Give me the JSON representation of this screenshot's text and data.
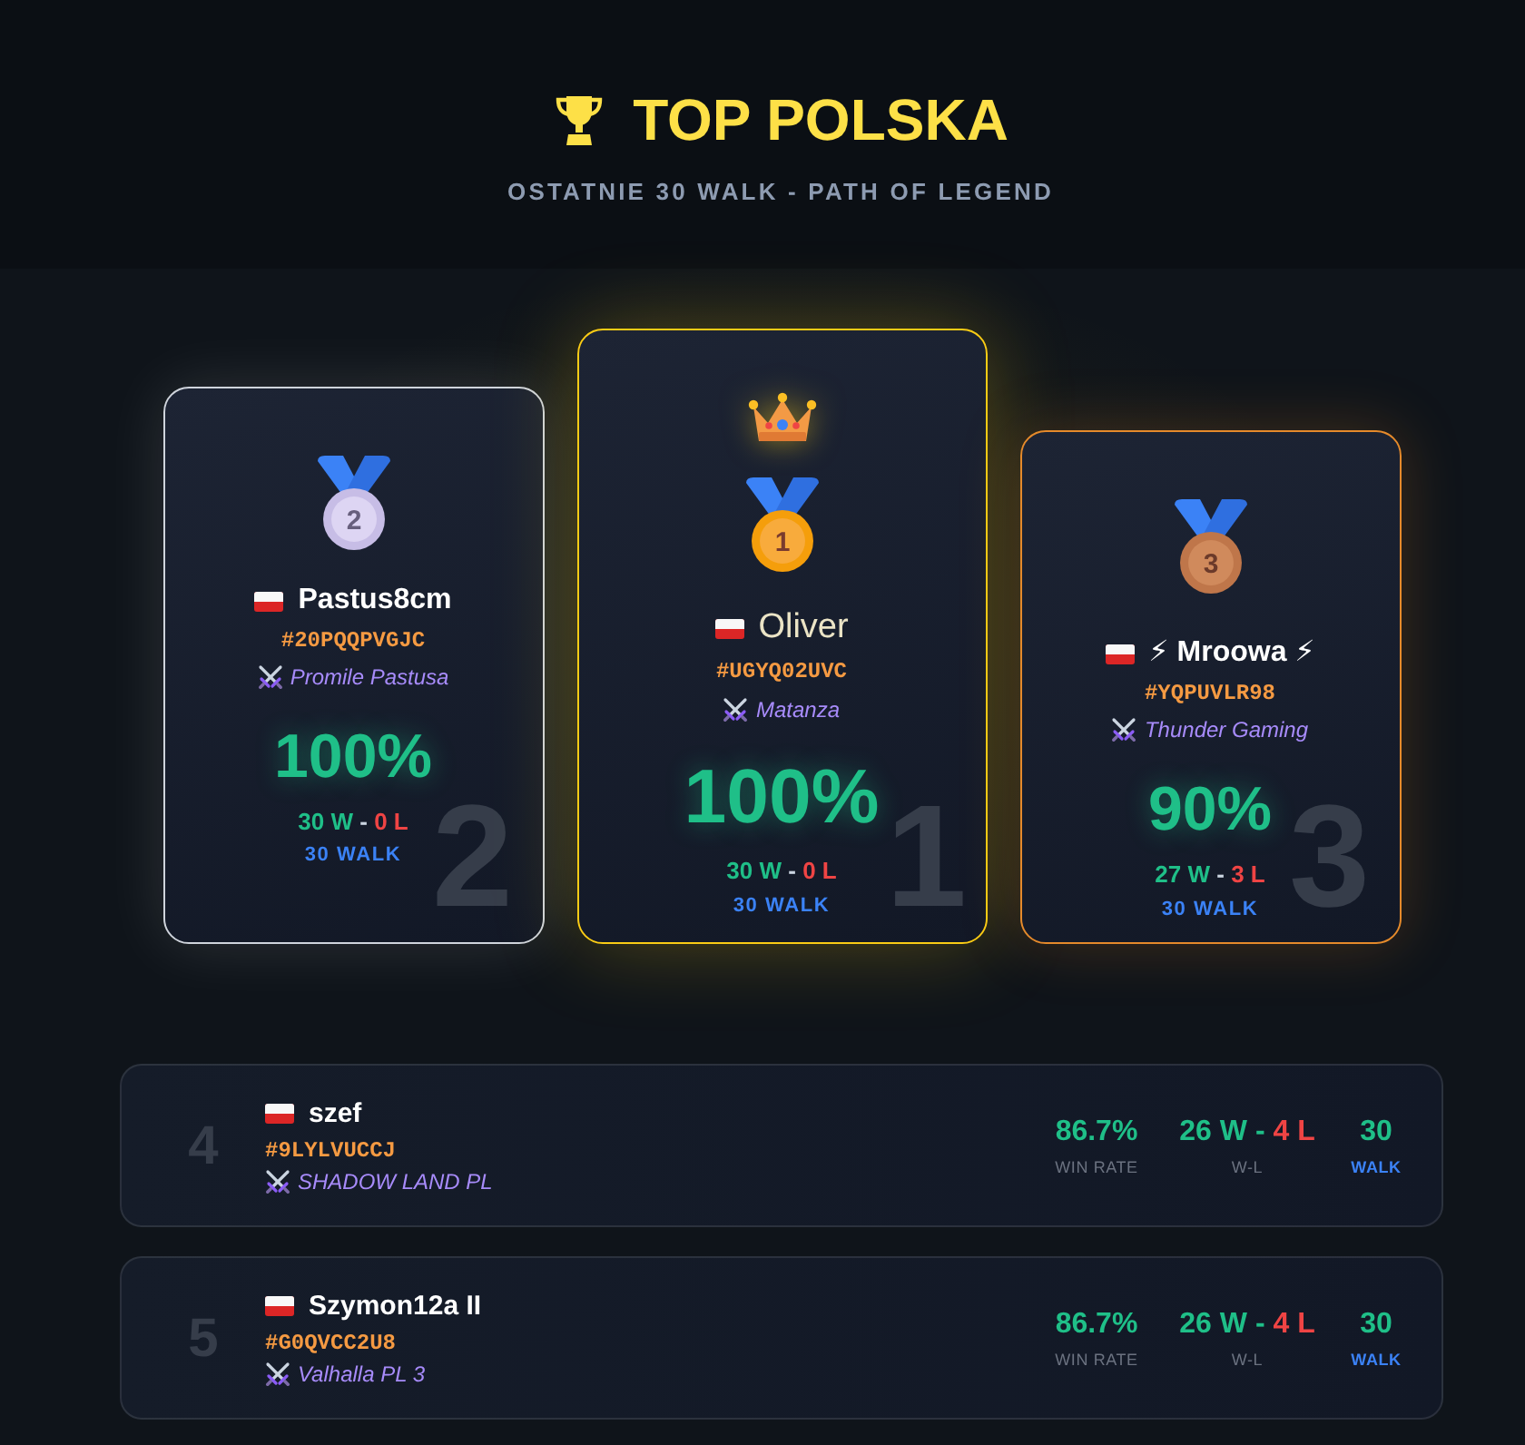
{
  "header": {
    "title": "TOP POLSKA",
    "subtitle": "OSTATNIE 30 WALK - PATH OF LEGEND"
  },
  "podium": [
    {
      "kind": "silver",
      "crown": false,
      "medal": "2",
      "name": "Pastus8cm",
      "tag": "#20PQQPVGJC",
      "clan": "Promile Pastusa",
      "win_rate": "100%",
      "wins": "30 W",
      "dash": "-",
      "losses": "0 L",
      "battles": "30 WALK",
      "rank": "2"
    },
    {
      "kind": "gold",
      "crown": true,
      "medal": "1",
      "name": "Oliver",
      "tag": "#UGYQ02UVC",
      "clan": "Matanza",
      "win_rate": "100%",
      "wins": "30 W",
      "dash": "-",
      "losses": "0 L",
      "battles": "30 WALK",
      "rank": "1"
    },
    {
      "kind": "bronze",
      "crown": false,
      "medal": "3",
      "name": "⚡ Mroowa ⚡",
      "tag": "#YQPUVLR98",
      "clan": "Thunder Gaming",
      "win_rate": "90%",
      "wins": "27 W",
      "dash": "-",
      "losses": "3 L",
      "battles": "30 WALK",
      "rank": "3"
    }
  ],
  "rows": [
    {
      "rank": "4",
      "name": "szef",
      "tag": "#9LYLVUCCJ",
      "clan": "SHADOW LAND PL",
      "stats": [
        {
          "kind": "win_rate",
          "value": "86.7%",
          "label": "WIN RATE"
        },
        {
          "kind": "record",
          "wins": "26 W",
          "dash": "-",
          "losses": "4 L",
          "label": "W-L"
        },
        {
          "kind": "battles",
          "value": "30",
          "label": "WALK"
        }
      ]
    },
    {
      "rank": "5",
      "name": "Szymon12a II",
      "tag": "#G0QVCC2U8",
      "clan": "Valhalla PL 3",
      "stats": [
        {
          "kind": "win_rate",
          "value": "86.7%",
          "label": "WIN RATE"
        },
        {
          "kind": "record",
          "wins": "26 W",
          "dash": "-",
          "losses": "4 L",
          "label": "W-L"
        },
        {
          "kind": "battles",
          "value": "30",
          "label": "WALK"
        }
      ]
    }
  ]
}
